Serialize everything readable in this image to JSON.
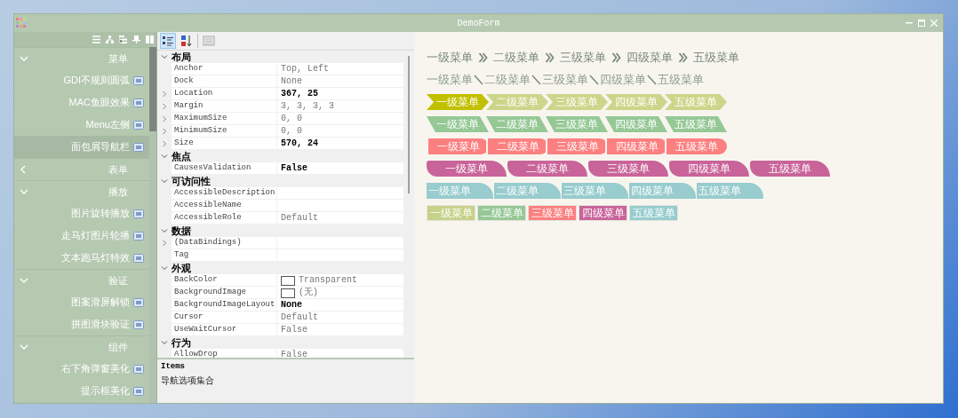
{
  "window": {
    "title": "DemoForm"
  },
  "sidebar": {
    "groups": [
      {
        "label": "菜单",
        "expanded": true,
        "children": [
          {
            "label": "GDI不规则圆弧",
            "selected": false
          },
          {
            "label": "MAC鱼眼效果",
            "selected": false
          },
          {
            "label": "Menu左侧",
            "selected": false
          },
          {
            "label": "面包屑导航栏",
            "selected": true
          }
        ]
      },
      {
        "label": "表单",
        "expanded": false
      },
      {
        "label": "播放",
        "expanded": true,
        "children": [
          {
            "label": "图片旋转播放",
            "selected": false
          },
          {
            "label": "走马灯图片轮播",
            "selected": false
          },
          {
            "label": "文本跑马灯特效",
            "selected": false
          }
        ]
      },
      {
        "label": "验证",
        "expanded": true,
        "children": [
          {
            "label": "图案滑屏解锁",
            "selected": false
          },
          {
            "label": "拼图滑块验证",
            "selected": false
          }
        ]
      },
      {
        "label": "组件",
        "expanded": true,
        "children": [
          {
            "label": "右下角弹窗美化",
            "selected": false
          },
          {
            "label": "提示框美化",
            "selected": false
          }
        ]
      }
    ]
  },
  "property_grid": {
    "toolbar": [
      {
        "kind": "categorized",
        "selected": true
      },
      {
        "kind": "alphabetical",
        "selected": false
      },
      {
        "kind": "pages",
        "selected": false
      }
    ],
    "categories": [
      {
        "label": "布局",
        "expanded": true,
        "properties": [
          {
            "name": "Anchor",
            "value": "Top, Left",
            "expandable": false,
            "bold": false
          },
          {
            "name": "Dock",
            "value": "None",
            "expandable": false,
            "bold": false
          },
          {
            "name": "Location",
            "value": "367, 25",
            "expandable": true,
            "bold": true
          },
          {
            "name": "Margin",
            "value": "3, 3, 3, 3",
            "expandable": true,
            "bold": false
          },
          {
            "name": "MaximumSize",
            "value": "0, 0",
            "expandable": true,
            "bold": false
          },
          {
            "name": "MinimumSize",
            "value": "0, 0",
            "expandable": true,
            "bold": false
          },
          {
            "name": "Size",
            "value": "570, 24",
            "expandable": true,
            "bold": true
          }
        ]
      },
      {
        "label": "焦点",
        "expanded": true,
        "properties": [
          {
            "name": "CausesValidation",
            "value": "False",
            "expandable": false,
            "bold": true
          }
        ]
      },
      {
        "label": "可访问性",
        "expanded": true,
        "properties": [
          {
            "name": "AccessibleDescription",
            "expandable": false,
            "bold": false
          },
          {
            "name": "AccessibleName",
            "expandable": false,
            "bold": false
          },
          {
            "name": "AccessibleRole",
            "value": "Default",
            "expandable": false,
            "bold": false
          }
        ]
      },
      {
        "label": "数据",
        "expanded": true,
        "properties": [
          {
            "name": "(DataBindings)",
            "expandable": true,
            "bold": false
          },
          {
            "name": "Tag",
            "expandable": false,
            "bold": false
          }
        ]
      },
      {
        "label": "外观",
        "expanded": true,
        "properties": [
          {
            "name": "BackColor",
            "value": "Transparent",
            "expandable": false,
            "bold": false,
            "kind": "swatch"
          },
          {
            "name": "BackgroundImage",
            "value": "(无)",
            "expandable": false,
            "bold": false,
            "kind": "swatch"
          },
          {
            "name": "BackgroundImageLayout",
            "value": "None",
            "expandable": false,
            "bold": true
          },
          {
            "name": "Cursor",
            "value": "Default",
            "expandable": false,
            "bold": false
          },
          {
            "name": "UseWaitCursor",
            "value": "False",
            "expandable": false,
            "bold": false
          }
        ]
      },
      {
        "label": "行为",
        "expanded": true,
        "properties": [
          {
            "name": "AllowDrop",
            "value": "False",
            "expandable": false,
            "bold": false
          }
        ]
      }
    ],
    "description": {
      "title": "Items",
      "text": "导航选项集合"
    }
  },
  "breadcrumbs": [
    {
      "kind": "chevron-text",
      "items": [
        {
          "label": "一级菜单"
        },
        {
          "label": "二级菜单"
        },
        {
          "label": "三级菜单"
        },
        {
          "label": "四级菜单"
        },
        {
          "label": "五级菜单"
        }
      ]
    },
    {
      "kind": "slash-text",
      "items": [
        {
          "label": "一级菜单"
        },
        {
          "label": "二级菜单"
        },
        {
          "label": "三级菜单"
        },
        {
          "label": "四级菜单"
        },
        {
          "label": "五级菜单"
        }
      ]
    },
    {
      "kind": "arrow",
      "items": [
        {
          "label": "一级菜单",
          "selected": true
        },
        {
          "label": "二级菜单",
          "selected": false
        },
        {
          "label": "三级菜单",
          "selected": false
        },
        {
          "label": "四级菜单",
          "selected": false
        },
        {
          "label": "五级菜单",
          "selected": false
        }
      ]
    },
    {
      "kind": "parallelogram",
      "items": [
        {
          "label": "一级菜单"
        },
        {
          "label": "二级菜单"
        },
        {
          "label": "三级菜单"
        },
        {
          "label": "四级菜单"
        },
        {
          "label": "五级菜单"
        }
      ]
    },
    {
      "kind": "rounded",
      "items": [
        {
          "label": "一级菜单"
        },
        {
          "label": "二级菜单"
        },
        {
          "label": "三级菜单"
        },
        {
          "label": "四级菜单"
        },
        {
          "label": "五级菜单"
        }
      ]
    },
    {
      "kind": "tab",
      "items": [
        {
          "label": "一级菜单"
        },
        {
          "label": "二级菜单"
        },
        {
          "label": "三级菜单"
        },
        {
          "label": "四级菜单"
        },
        {
          "label": "五级菜单"
        }
      ]
    },
    {
      "kind": "small-tab",
      "items": [
        {
          "label": "一级菜单"
        },
        {
          "label": "二级菜单"
        },
        {
          "label": "三级菜单"
        },
        {
          "label": "四级菜单"
        },
        {
          "label": "五级菜单"
        }
      ]
    },
    {
      "kind": "block",
      "items": [
        {
          "label": "一级菜单",
          "color": "#c6d28a"
        },
        {
          "label": "二级菜单",
          "color": "#96c896"
        },
        {
          "label": "三级菜单",
          "color": "#fd8080"
        },
        {
          "label": "四级菜单",
          "color": "#c9649a"
        },
        {
          "label": "五级菜单",
          "color": "#98ccce"
        }
      ]
    }
  ]
}
